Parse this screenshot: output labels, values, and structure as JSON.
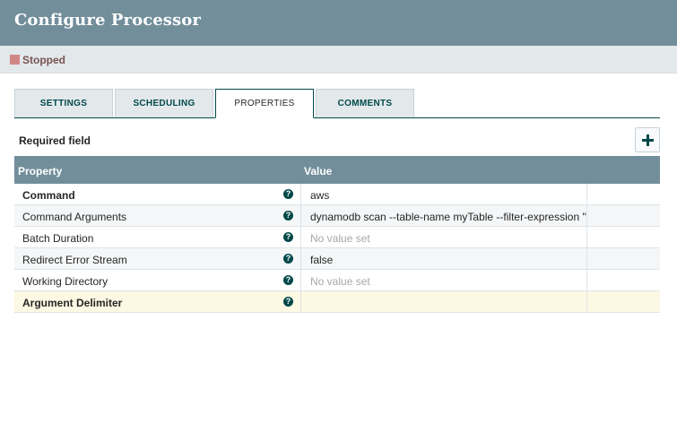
{
  "header": {
    "title": "Configure Processor"
  },
  "status": {
    "label": "Stopped",
    "color": "#d18686"
  },
  "tabs": [
    {
      "label": "SETTINGS",
      "active": false
    },
    {
      "label": "SCHEDULING",
      "active": false
    },
    {
      "label": "PROPERTIES",
      "active": true
    },
    {
      "label": "COMMENTS",
      "active": false
    }
  ],
  "required_label": "Required field",
  "table": {
    "columns": [
      "Property",
      "Value"
    ],
    "rows": [
      {
        "name": "Command",
        "required": true,
        "value": "aws",
        "empty": false
      },
      {
        "name": "Command Arguments",
        "required": false,
        "value": "dynamodb scan --table-name myTable --filter-expression \"",
        "empty": false
      },
      {
        "name": "Batch Duration",
        "required": false,
        "value": "No value set",
        "empty": true
      },
      {
        "name": "Redirect Error Stream",
        "required": false,
        "value": "false",
        "empty": false
      },
      {
        "name": "Working Directory",
        "required": false,
        "value": "No value set",
        "empty": true
      },
      {
        "name": "Argument Delimiter",
        "required": true,
        "value": "",
        "empty": false,
        "selected": true
      }
    ]
  },
  "colors": {
    "header_bg": "#728e9b",
    "accent": "#004849",
    "selected_row": "#fcf8e3"
  },
  "icons": {
    "help": "question-circle-icon",
    "add": "plus-icon",
    "status": "stopped-square-icon"
  }
}
